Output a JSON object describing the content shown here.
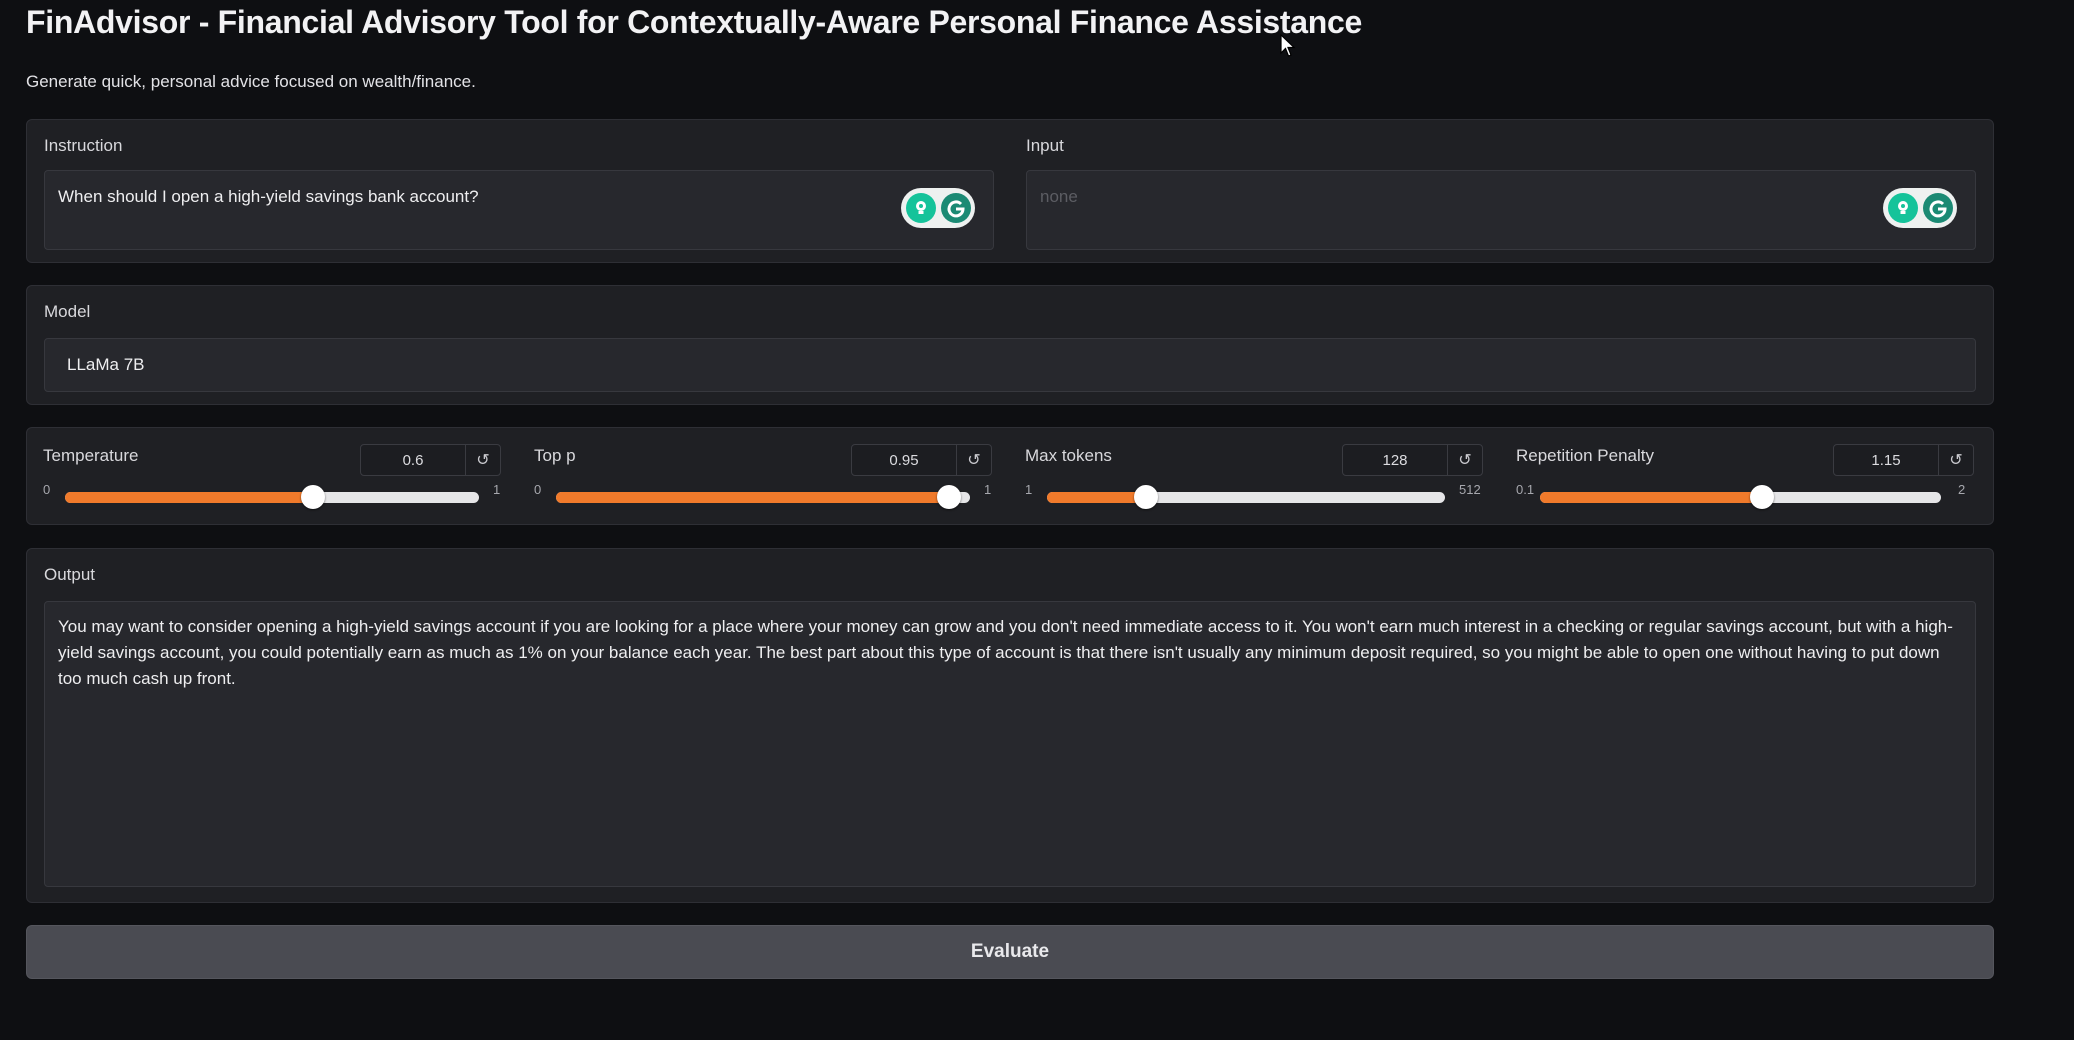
{
  "page": {
    "title": "FinAdvisor - Financial Advisory Tool for Contextually-Aware Personal Finance Assistance",
    "subtitle": "Generate quick, personal advice focused on wealth/finance."
  },
  "instruction": {
    "label": "Instruction",
    "value": "When should I open a high-yield savings bank account?"
  },
  "input": {
    "label": "Input",
    "placeholder": "none"
  },
  "model": {
    "label": "Model",
    "value": "LLaMa 7B"
  },
  "sliders": {
    "temperature": {
      "label": "Temperature",
      "value": "0.6",
      "min": "0",
      "max": "1",
      "fraction": 0.6
    },
    "top_p": {
      "label": "Top p",
      "value": "0.95",
      "min": "0",
      "max": "1",
      "fraction": 0.95
    },
    "max_tokens": {
      "label": "Max tokens",
      "value": "128",
      "min": "1",
      "max": "512",
      "fraction": 0.2485
    },
    "repetition_penalty": {
      "label": "Repetition Penalty",
      "value": "1.15",
      "min": "0.1",
      "max": "2",
      "fraction": 0.5526
    }
  },
  "output": {
    "label": "Output",
    "value": "You may want to consider opening a high-yield savings account if you are looking for a place where your money can grow and you don't need immediate access to it. You won't earn much interest in a checking or regular savings account, but with a high-yield savings account, you could potentially earn as much as 1% on your balance each year. The best part about this type of account is that there isn't usually any minimum deposit required, so you might be able to open one without having to put down too much cash up front."
  },
  "actions": {
    "evaluate_label": "Evaluate"
  },
  "icons": {
    "reset": "reset-icon",
    "grammarly": "grammarly-icon",
    "cursor": "mouse-cursor-icon"
  },
  "colors": {
    "accent": "#f07a2b",
    "background": "#0e0f12",
    "panel": "#1f2024",
    "grammarly_green": "#15c39a"
  }
}
